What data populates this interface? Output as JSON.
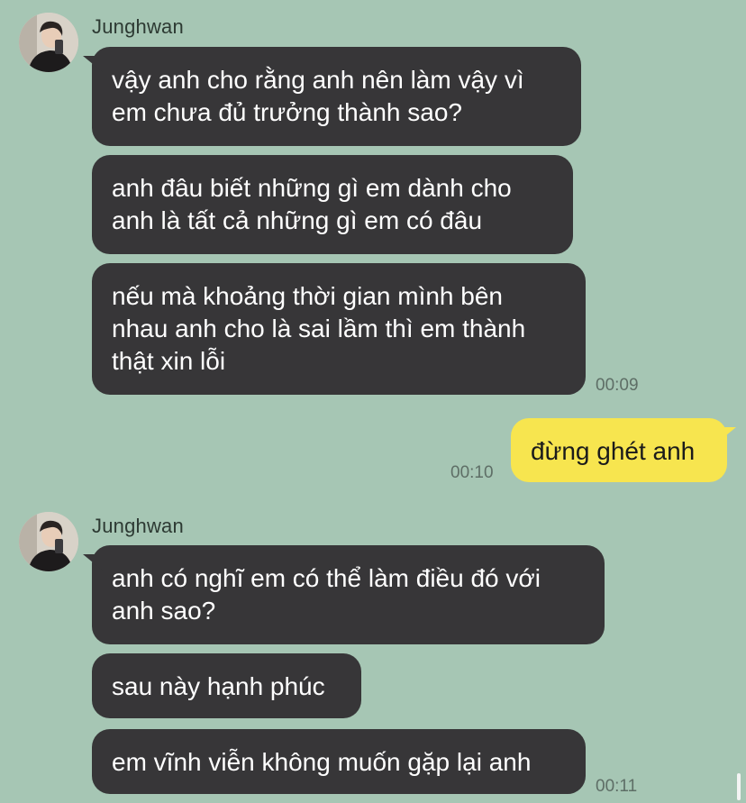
{
  "chat": {
    "groups": [
      {
        "sender": "Junghwan",
        "avatar_icon": "profile-photo",
        "messages": [
          "vậy anh cho rằng anh nên làm vậy vì\nem chưa đủ trưởng thành sao?",
          "anh đâu biết những gì em dành cho\nanh là tất cả những gì em có đâu",
          "nếu mà khoảng thời gian mình bên\nnhau anh cho là sai lầm thì em thành\nthật xin lỗi"
        ],
        "time": "00:09"
      },
      {
        "sender": "me",
        "messages": [
          "đừng ghét anh"
        ],
        "time": "00:10"
      },
      {
        "sender": "Junghwan",
        "avatar_icon": "profile-photo",
        "messages": [
          "anh có nghĩ em có thể làm điều đó với\nanh sao?",
          "sau này hạnh phúc",
          "em vĩnh viễn không muốn gặp lại anh"
        ],
        "time": "00:11"
      }
    ]
  },
  "colors": {
    "background": "#a6c6b4",
    "incoming_bubble": "#373638",
    "outgoing_bubble": "#f7e54f"
  }
}
